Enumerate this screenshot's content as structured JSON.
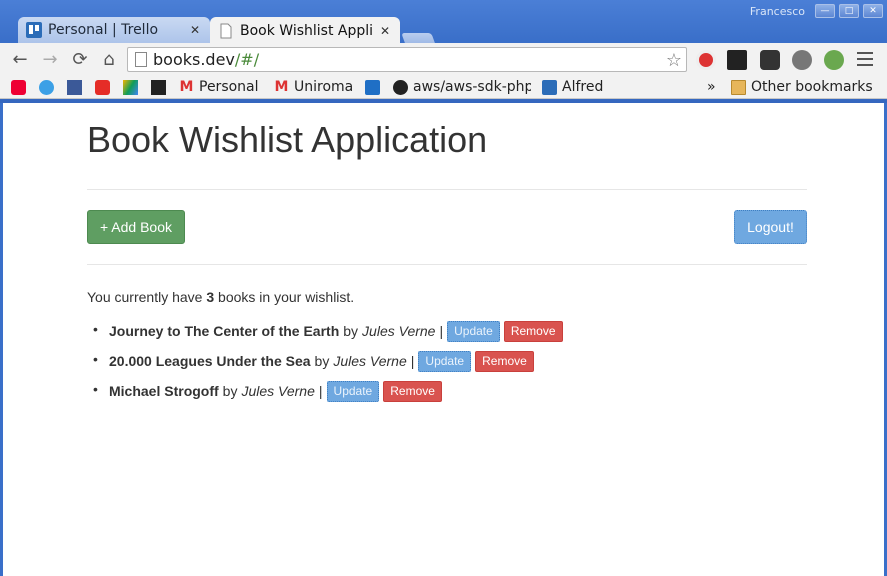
{
  "window": {
    "user": "Francesco"
  },
  "tabs": [
    {
      "title": "Personal | Trello",
      "active": false,
      "icon": "trello-icon"
    },
    {
      "title": "Book Wishlist Applic",
      "active": true,
      "icon": "page-icon"
    }
  ],
  "address": {
    "host": "books.dev",
    "path": "/#/"
  },
  "bookmarks": [
    {
      "label": "",
      "icon": "star-icon"
    },
    {
      "label": "",
      "icon": "twitter-icon"
    },
    {
      "label": "",
      "icon": "facebook-icon"
    },
    {
      "label": "",
      "icon": "youtube-icon"
    },
    {
      "label": "",
      "icon": "drive-icon"
    },
    {
      "label": "",
      "icon": "hashtag-icon"
    },
    {
      "label": "Personal",
      "icon": "gmail-icon"
    },
    {
      "label": "Uniroma",
      "icon": "gmail-icon"
    },
    {
      "label": "",
      "icon": "outlook-icon"
    },
    {
      "label": "aws/aws-sdk-php",
      "icon": "github-icon"
    },
    {
      "label": "Alfred",
      "icon": "trello-icon"
    }
  ],
  "bookmarks_overflow": "»",
  "other_bookmarks": "Other bookmarks",
  "app": {
    "title": "Book Wishlist Application",
    "add_label": "+ Add Book",
    "logout_label": "Logout!",
    "summary_prefix": "You currently have",
    "count": "3",
    "summary_suffix": "books in your wishlist.",
    "books": [
      {
        "title": "Journey to The Center of the Earth",
        "by": "by",
        "author": "Jules Verne",
        "sep": "|",
        "update": "Update",
        "remove": "Remove"
      },
      {
        "title": "20.000 Leagues Under the Sea",
        "by": "by",
        "author": "Jules Verne",
        "sep": "|",
        "update": "Update",
        "remove": "Remove"
      },
      {
        "title": "Michael Strogoff",
        "by": "by",
        "author": "Jules Verne",
        "sep": "|",
        "update": "Update",
        "remove": "Remove"
      }
    ]
  },
  "colors": {
    "chrome_blue": "#3a6fc9",
    "success": "#5f9e62",
    "primary": "#6fa8e0",
    "danger": "#d9534f",
    "text": "#333333"
  }
}
